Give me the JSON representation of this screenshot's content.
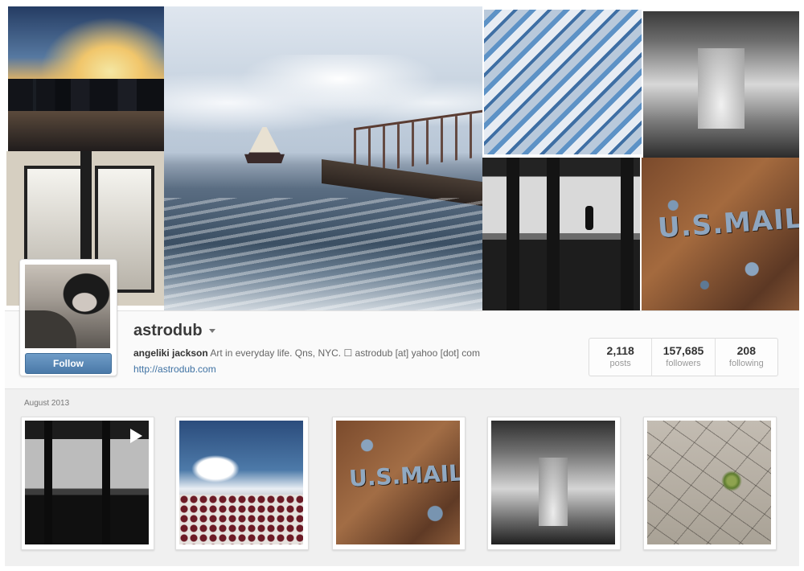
{
  "profile": {
    "username": "astrodub",
    "follow_label": "Follow",
    "full_name": "angeliki jackson",
    "bio_text": "Art in everyday life. Qns, NYC. ☐ astrodub [at] yahoo [dot] com",
    "website": "http://astrodub.com"
  },
  "stats": {
    "posts_count": "2,118",
    "posts_label": "posts",
    "followers_count": "157,685",
    "followers_label": "followers",
    "following_count": "208",
    "following_label": "following"
  },
  "cover": {
    "mailbox_text": "U.S.MAIL"
  },
  "grid": {
    "month_label": "August 2013",
    "items": [
      {
        "icon": "play-icon"
      },
      {
        "icon": ""
      },
      {
        "mailbox_text": "U.S.MAIL"
      },
      {
        "icon": ""
      },
      {
        "icon": ""
      }
    ]
  },
  "colors": {
    "link": "#3f72a3",
    "follow_button": "#4a79a8"
  }
}
